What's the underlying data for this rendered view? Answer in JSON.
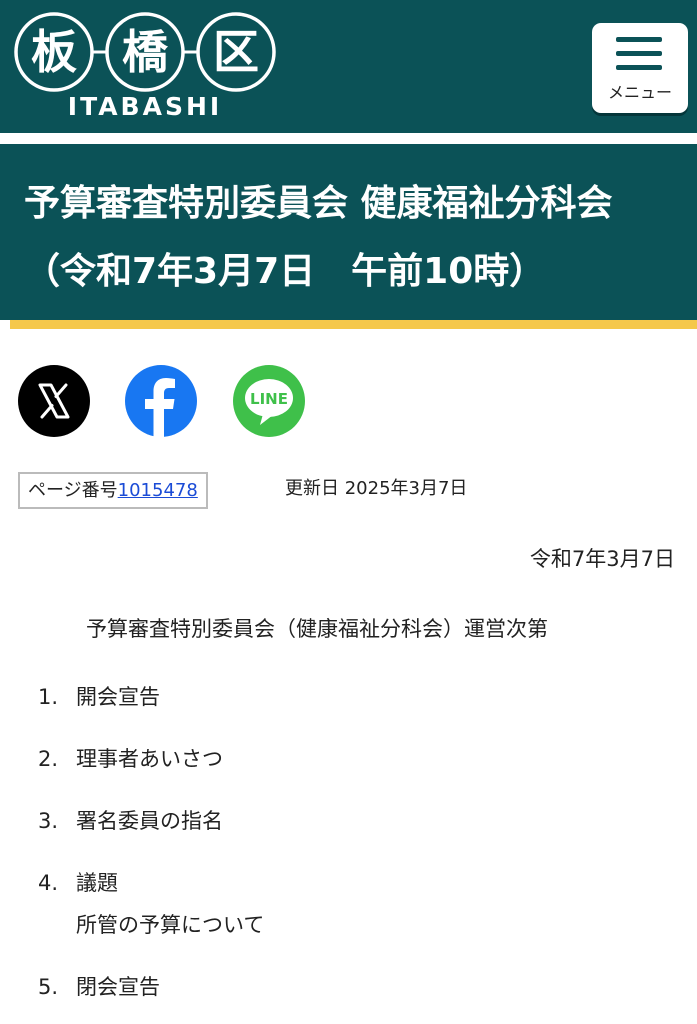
{
  "header": {
    "logo_kanji": [
      "板",
      "橋",
      "区"
    ],
    "logo_text": "ITABASHI",
    "menu_label": "メニュー"
  },
  "title": {
    "line1": "予算審査特別委員会 健康福祉分科会",
    "line2": "（令和7年3月7日　午前10時）"
  },
  "share": {
    "icons": [
      "x-icon",
      "facebook-icon",
      "line-icon"
    ],
    "line_text": "LINE"
  },
  "meta": {
    "page_no_label": "ページ番号",
    "page_no_value": "1015478",
    "updated": "更新日 2025年3月7日"
  },
  "content": {
    "date": "令和7年3月7日",
    "agenda_heading": "予算審査特別委員会（健康福祉分科会）運営次第",
    "items": [
      {
        "num": "1.",
        "text": "開会宣告"
      },
      {
        "num": "2.",
        "text": "理事者あいさつ"
      },
      {
        "num": "3.",
        "text": "署名委員の指名"
      },
      {
        "num": "4.",
        "text": "議題",
        "sub": "所管の予算について"
      },
      {
        "num": "5.",
        "text": "閉会宣告"
      }
    ]
  },
  "colors": {
    "brand": "#0b5257",
    "accent": "#f5c84b",
    "link": "#1a4bd6",
    "facebook": "#1877f2",
    "line": "#3fc04a"
  }
}
